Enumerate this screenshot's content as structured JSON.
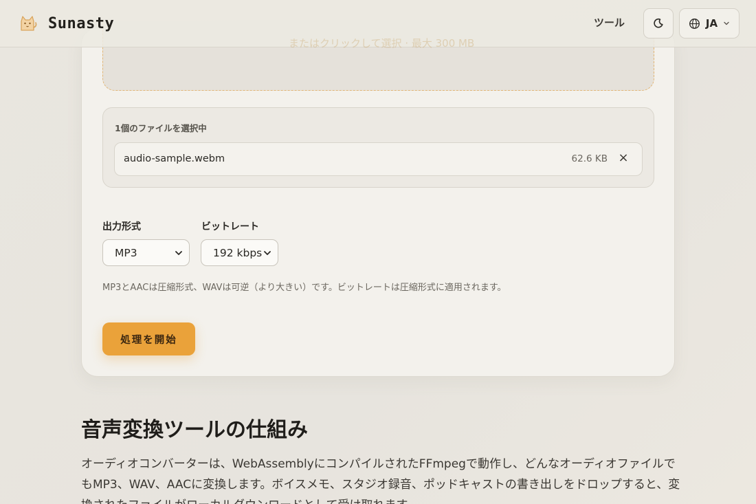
{
  "header": {
    "brand": "Sunasty",
    "nav_tools": "ツール",
    "language": "JA"
  },
  "upload": {
    "limit_text": "またはクリックして選択 · 最大 300 MB",
    "selected_count": "1個のファイルを選択中",
    "files": [
      {
        "name": "audio-sample.webm",
        "size": "62.6 KB",
        "remove": "×"
      }
    ]
  },
  "options": {
    "format_label": "出力形式",
    "format_value": "MP3",
    "bitrate_label": "ビットレート",
    "bitrate_value": "192 kbps",
    "hint": "MP3とAACは圧縮形式、WAVは可逆（より大きい）です。ビットレートは圧縮形式に適用されます。"
  },
  "actions": {
    "start": "処理を開始"
  },
  "article": {
    "heading": "音声変換ツールの仕組み",
    "body": "オーディオコンバーターは、WebAssemblyにコンパイルされたFFmpegで動作し、どんなオーディオファイルでもMP3、WAV、AACに変換します。ボイスメモ、スタジオ録音、ポッドキャストの書き出しをドロップすると、変換されたファイルがローカルダウンロードとして受け取れます。"
  },
  "colors": {
    "accent": "#EAA23A",
    "background": "#E8E5DF",
    "card": "#F3F1EC"
  },
  "icons": {
    "logo": "cat-logo-icon",
    "theme": "moon-icon",
    "language": "globe-icon",
    "language_chevron": "chevron-down-icon",
    "select_chevron": "chevron-down-icon",
    "remove": "close-icon"
  }
}
